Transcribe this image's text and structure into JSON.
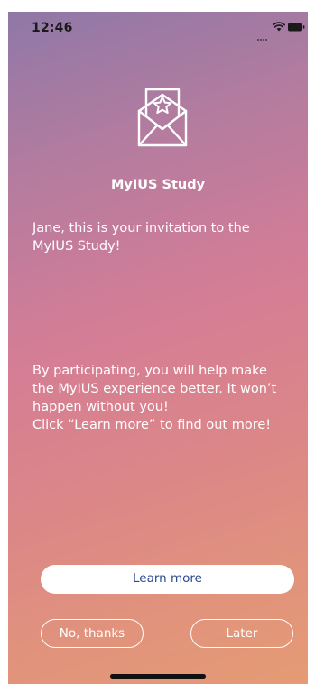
{
  "status_bar": {
    "time": "12:46",
    "icons": [
      "signal-dots-icon",
      "wifi-icon",
      "battery-icon"
    ]
  },
  "header": {
    "icon": "envelope-star-icon",
    "title": "MyIUS Study"
  },
  "content": {
    "invitation": "Jane, this is your invitation to the MyIUS Study!",
    "participation": "By participating, you will help make the MyIUS experience better. It won’t happen without you!\nClick “Learn more” to find out more!"
  },
  "actions": {
    "learn_more_label": "Learn more",
    "no_thanks_label": "No, thanks",
    "later_label": "Later"
  },
  "colors": {
    "gradient_top": "#8f78a7",
    "gradient_middle": "#d47d96",
    "gradient_bottom": "#e59b74",
    "primary_button_text": "#2b4a8f",
    "text": "#ffffff"
  }
}
